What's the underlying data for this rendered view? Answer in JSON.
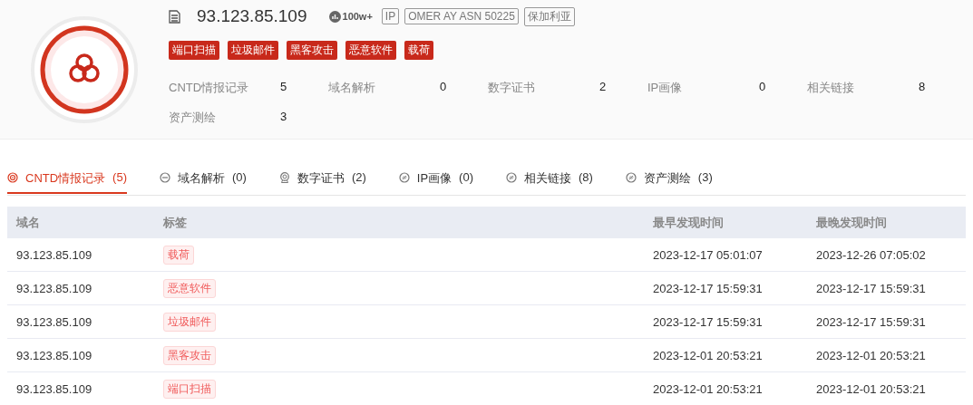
{
  "header": {
    "title": "93.123.85.109",
    "heat": "100w+",
    "badges": [
      "IP",
      "OMER AY ASN 50225",
      "保加利亚"
    ],
    "threat_tags": [
      "端口扫描",
      "垃圾邮件",
      "黑客攻击",
      "恶意软件",
      "载荷"
    ],
    "stats": [
      {
        "label": "CNTD情报记录",
        "value": "5"
      },
      {
        "label": "域名解析",
        "value": "0"
      },
      {
        "label": "数字证书",
        "value": "2"
      },
      {
        "label": "IP画像",
        "value": "0"
      },
      {
        "label": "相关链接",
        "value": "8"
      },
      {
        "label": "资产测绘",
        "value": "3"
      }
    ]
  },
  "tabs": [
    {
      "kind": "target",
      "label": "CNTD情报记录",
      "count": "(5)",
      "selected": true
    },
    {
      "kind": "minus",
      "label": "域名解析",
      "count": "(0)",
      "selected": false
    },
    {
      "kind": "medal",
      "label": "数字证书",
      "count": "(2)",
      "selected": false
    },
    {
      "kind": "link",
      "label": "IP画像",
      "count": "(0)",
      "selected": false
    },
    {
      "kind": "link",
      "label": "相关链接",
      "count": "(8)",
      "selected": false
    },
    {
      "kind": "link",
      "label": "资产测绘",
      "count": "(3)",
      "selected": false
    }
  ],
  "table": {
    "columns": [
      "域名",
      "标签",
      "最早发现时间",
      "最晚发现时间"
    ],
    "rows": [
      {
        "domain": "93.123.85.109",
        "tag": "载荷",
        "first_seen": "2023-12-17 05:01:07",
        "last_seen": "2023-12-26 07:05:02"
      },
      {
        "domain": "93.123.85.109",
        "tag": "恶意软件",
        "first_seen": "2023-12-17 15:59:31",
        "last_seen": "2023-12-17 15:59:31"
      },
      {
        "domain": "93.123.85.109",
        "tag": "垃圾邮件",
        "first_seen": "2023-12-17 15:59:31",
        "last_seen": "2023-12-17 15:59:31"
      },
      {
        "domain": "93.123.85.109",
        "tag": "黑客攻击",
        "first_seen": "2023-12-01 20:53:21",
        "last_seen": "2023-12-01 20:53:21"
      },
      {
        "domain": "93.123.85.109",
        "tag": "端口扫描",
        "first_seen": "2023-12-01 20:53:21",
        "last_seen": "2023-12-01 20:53:21"
      }
    ]
  }
}
